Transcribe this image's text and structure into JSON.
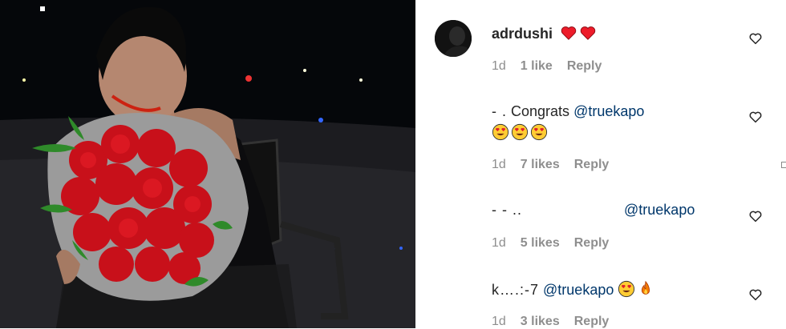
{
  "comments": [
    {
      "username": "adrdushi",
      "emoji": [
        "red-heart",
        "red-heart"
      ],
      "time": "1d",
      "likes": "1 like",
      "reply": "Reply"
    },
    {
      "username_redacted": "-   .",
      "text": "Congrats",
      "mention": "@truekapo",
      "emoji": [
        "heart-eyes",
        "heart-eyes",
        "heart-eyes"
      ],
      "time": "1d",
      "likes": "7 likes",
      "reply": "Reply"
    },
    {
      "username_redacted": "-        -         ..",
      "mention": "@truekapo",
      "time": "1d",
      "likes": "5 likes",
      "reply": "Reply"
    },
    {
      "username_partial": "k….:-7",
      "mention": "@truekapo",
      "emoji": [
        "heart-eyes",
        "fire"
      ],
      "time": "1d",
      "likes": "3 likes",
      "reply": "Reply"
    }
  ],
  "icons": {
    "like": "heart-outline-icon",
    "avatar": "avatar"
  },
  "colors": {
    "mention": "#00376b",
    "meta": "#8e8e8e",
    "text": "#262626",
    "heart": "#ed1c2a"
  }
}
